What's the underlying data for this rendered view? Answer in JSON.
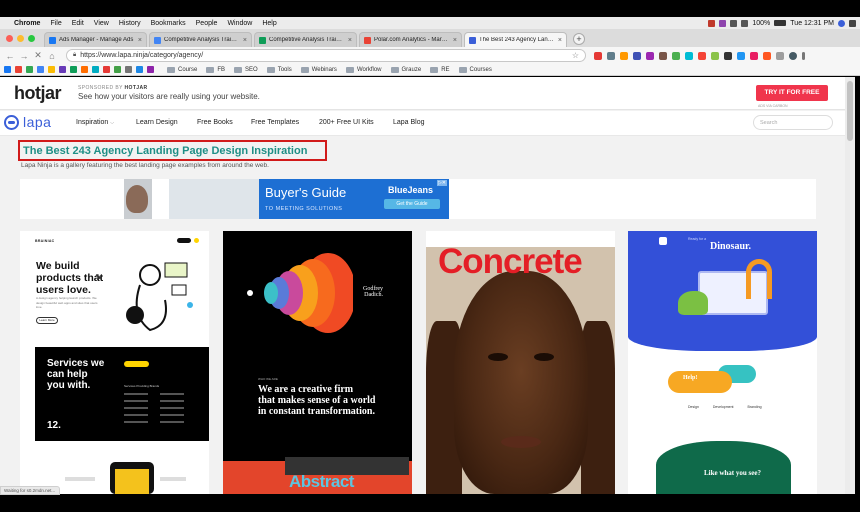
{
  "menubar": {
    "app": "Chrome",
    "items": [
      "File",
      "Edit",
      "View",
      "History",
      "Bookmarks",
      "People",
      "Window",
      "Help"
    ],
    "battery": "100%",
    "clock": "Tue 12:31 PM"
  },
  "tabs": [
    {
      "label": "Ads Manager - Manage Ads",
      "color": "#1877f2",
      "active": false
    },
    {
      "label": "Competitive Analysis Training",
      "color": "#4285f4",
      "active": false
    },
    {
      "label": "Competitive Analysis Training",
      "color": "#0f9d58",
      "active": false
    },
    {
      "label": "Polar.com Analytics - Market S",
      "color": "#e94235",
      "active": false
    },
    {
      "label": "The Best 243 Agency Landing",
      "color": "#3b5fd8",
      "active": true
    }
  ],
  "address": {
    "url": "https://www.lapa.ninja/category/agency/"
  },
  "bookmarks": {
    "folders": [
      "Course",
      "FB",
      "SEO",
      "Tools",
      "Webinars",
      "Workflow",
      "Grauze",
      "RE",
      "Courses"
    ]
  },
  "hotjar": {
    "logo": "hotjar",
    "sponsored_by": "SPONSORED BY",
    "sponsor_name": "HOTJAR",
    "tagline": "See how your visitors are really using your website.",
    "cta": "TRY IT FOR FREE",
    "ads_via": "ADS VIA CARBON"
  },
  "nav": {
    "logo": "lapa",
    "items": [
      "Inspiration",
      "Learn Design",
      "Free Books",
      "Free Templates",
      "200+ Free UI Kits",
      "Lapa Blog"
    ],
    "search_placeholder": "Search"
  },
  "hero": {
    "title": "The Best 243 Agency Landing Page Design Inspiration",
    "subtitle": "Lapa Ninja is a gallery featuring the best landing page examples from around the web."
  },
  "ad": {
    "title": "Buyer's Guide",
    "subtitle": "TO MEETING SOLUTIONS",
    "brand": "BlueJeans",
    "button": "Get the Guide"
  },
  "cards": {
    "c1": {
      "header": "BRAINIAC",
      "headline_1": "We build",
      "headline_2": "products that",
      "headline_3": "users love.",
      "body": "A design agency helping launch products. We design beautiful web apps and sites that users love.",
      "button": "Learn More",
      "dark_line_1": "Services we",
      "dark_line_2": "can help",
      "dark_line_3": "you with.",
      "number": "12.",
      "services_header": "Services Providing Brands"
    },
    "c2": {
      "logo_1": "Godfrey",
      "logo_2": "Dadich.",
      "kicker": "WHO WE ARE",
      "headline_1": "We are a creative firm",
      "headline_2": "that makes sense of a world",
      "headline_3": "in constant transformation.",
      "footer_word": "Abstract"
    },
    "c3": {
      "headline": "Concrete"
    },
    "c4": {
      "pre": "Ready for a",
      "title": "Dinosaur.",
      "help": "Help!",
      "labels": [
        "Design",
        "Development",
        "Branding"
      ],
      "like": "Like what you see?"
    }
  },
  "status_text": "Waiting for s0.2mdn.net..."
}
